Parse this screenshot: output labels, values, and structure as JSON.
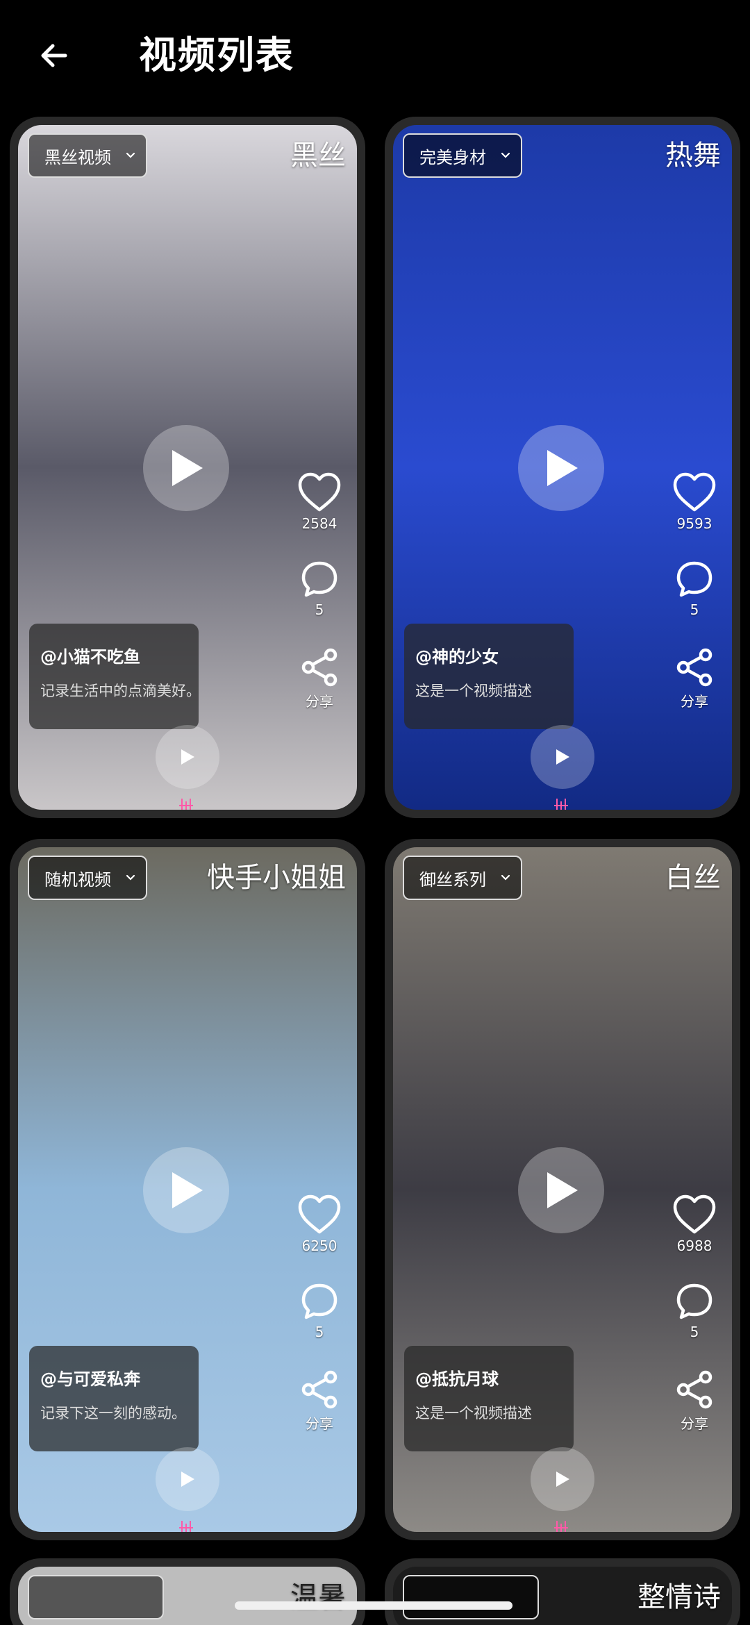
{
  "header": {
    "title": "视频列表"
  },
  "cards": [
    {
      "category": "黑丝视频",
      "title": "黑丝",
      "likes": "2584",
      "comments": "5",
      "share_label": "分享",
      "author": "@小猫不吃鱼",
      "description": "记录生活中的点滴美好。",
      "bg_top": "#d9d7dc",
      "bg_mid": "#5a5a68",
      "bg_bottom": "#c9c6c8"
    },
    {
      "category": "完美身材",
      "title": "热舞",
      "likes": "9593",
      "comments": "5",
      "share_label": "分享",
      "author": "@神的少女",
      "description": "这是一个视频描述",
      "bg_top": "#1d3aa8",
      "bg_mid": "#2a4bd0",
      "bg_bottom": "#122a84"
    },
    {
      "category": "随机视频",
      "title": "快手小姐姐",
      "likes": "6250",
      "comments": "5",
      "share_label": "分享",
      "author": "@与可爱私奔",
      "description": "记录下这一刻的感动。",
      "bg_top": "#6c6a60",
      "bg_mid": "#8fb6d8",
      "bg_bottom": "#a9c9e6"
    },
    {
      "category": "御丝系列",
      "title": "白丝",
      "likes": "6988",
      "comments": "5",
      "share_label": "分享",
      "author": "@抵抗月球",
      "description": "这是一个视频描述",
      "bg_top": "#7f7a72",
      "bg_mid": "#3d3c44",
      "bg_bottom": "#8d8a86"
    }
  ],
  "peek_cards": [
    {
      "title": "温暑"
    },
    {
      "title": "整情诗"
    }
  ]
}
